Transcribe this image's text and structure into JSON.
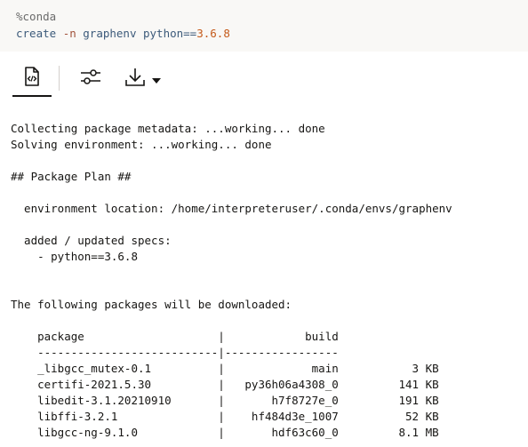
{
  "code": {
    "line1": "%conda",
    "line2_cmd": "create ",
    "line2_flag": "-n",
    "line2_mid": " graphenv python==",
    "line2_version": "3.6.8"
  },
  "toolbar": {
    "buttons": [
      {
        "name": "code-view",
        "icon": "file-code-icon"
      },
      {
        "name": "settings",
        "icon": "sliders-icon"
      },
      {
        "name": "download",
        "icon": "download-icon",
        "dropdown": "chevron-down-icon"
      }
    ]
  },
  "output": {
    "lines": [
      "Collecting package metadata: ...working... done",
      "Solving environment: ...working... done",
      "",
      "## Package Plan ##",
      "",
      "  environment location: /home/interpreteruser/.conda/envs/graphenv",
      "",
      "  added / updated specs:",
      "    - python==3.6.8",
      "",
      "",
      "The following packages will be downloaded:",
      "",
      "    package                    |            build",
      "    ---------------------------|-----------------",
      "    _libgcc_mutex-0.1          |             main           3 KB",
      "    certifi-2021.5.30          |   py36h06a4308_0         141 KB",
      "    libedit-3.1.20210910       |       h7f8727e_0         191 KB",
      "    libffi-3.2.1               |    hf484d3e_1007          52 KB",
      "    libgcc-ng-9.1.0            |       hdf63c60_0         8.1 MB"
    ]
  }
}
